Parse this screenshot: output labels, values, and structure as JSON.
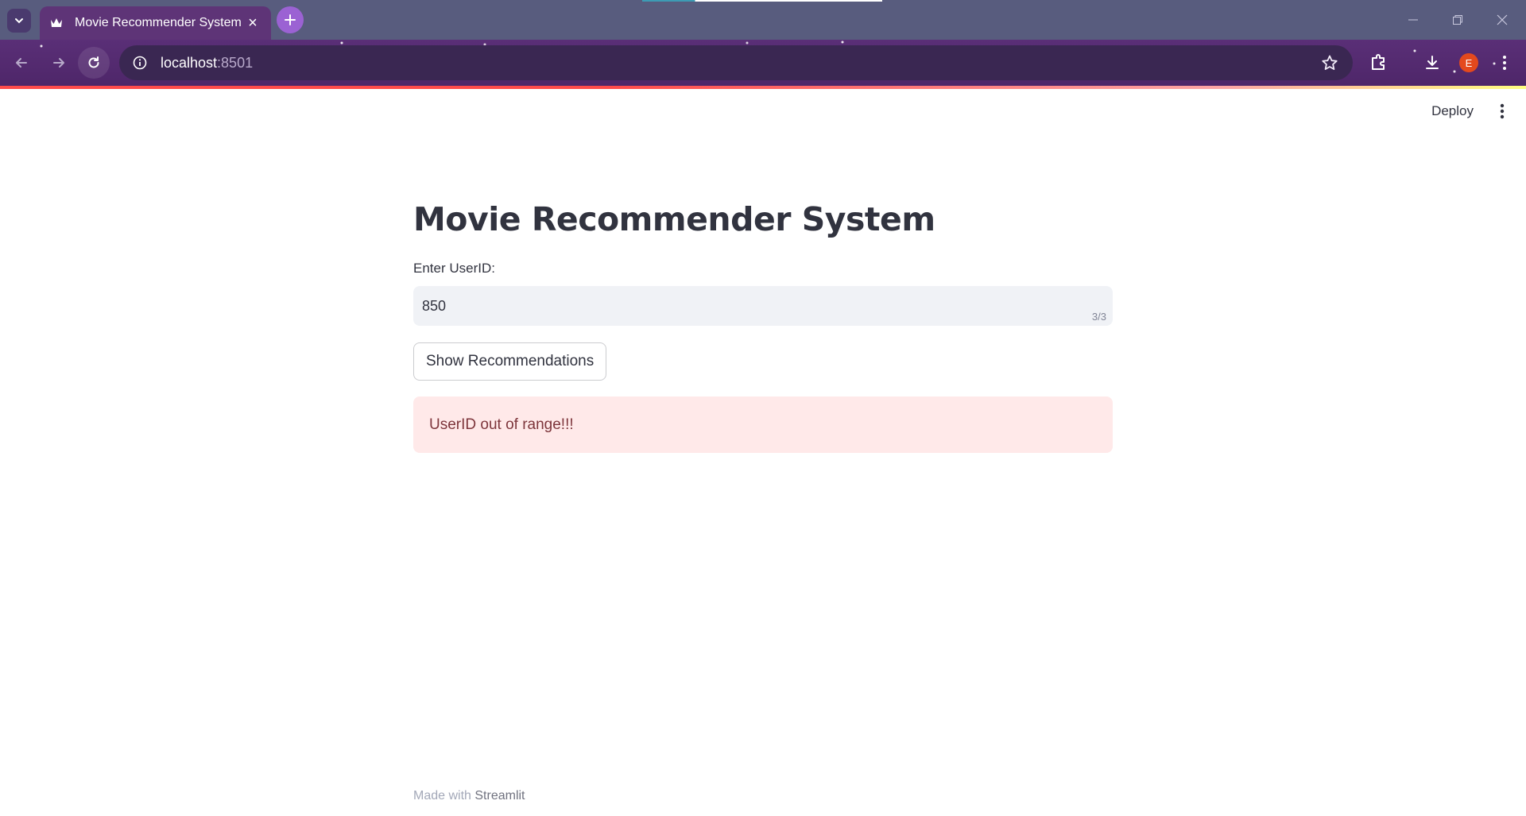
{
  "browser": {
    "tab": {
      "title": "Movie Recommender System"
    },
    "address_bar": {
      "host": "localhost",
      "port": ":8501"
    },
    "profile_initial": "E"
  },
  "app": {
    "header": {
      "deploy_label": "Deploy"
    },
    "title": "Movie Recommender System",
    "input": {
      "label": "Enter UserID:",
      "value": "850",
      "counter": "3/3"
    },
    "button": {
      "label": "Show Recommendations"
    },
    "error": {
      "message": "UserID out of range!!!"
    },
    "footer": {
      "prefix": "Made with",
      "link": "Streamlit"
    }
  },
  "colors": {
    "accent": "#ff4b4b",
    "text": "#31333f",
    "error_bg": "#ffe9e9",
    "error_text": "#7d353b",
    "input_bg": "#f0f2f6"
  }
}
